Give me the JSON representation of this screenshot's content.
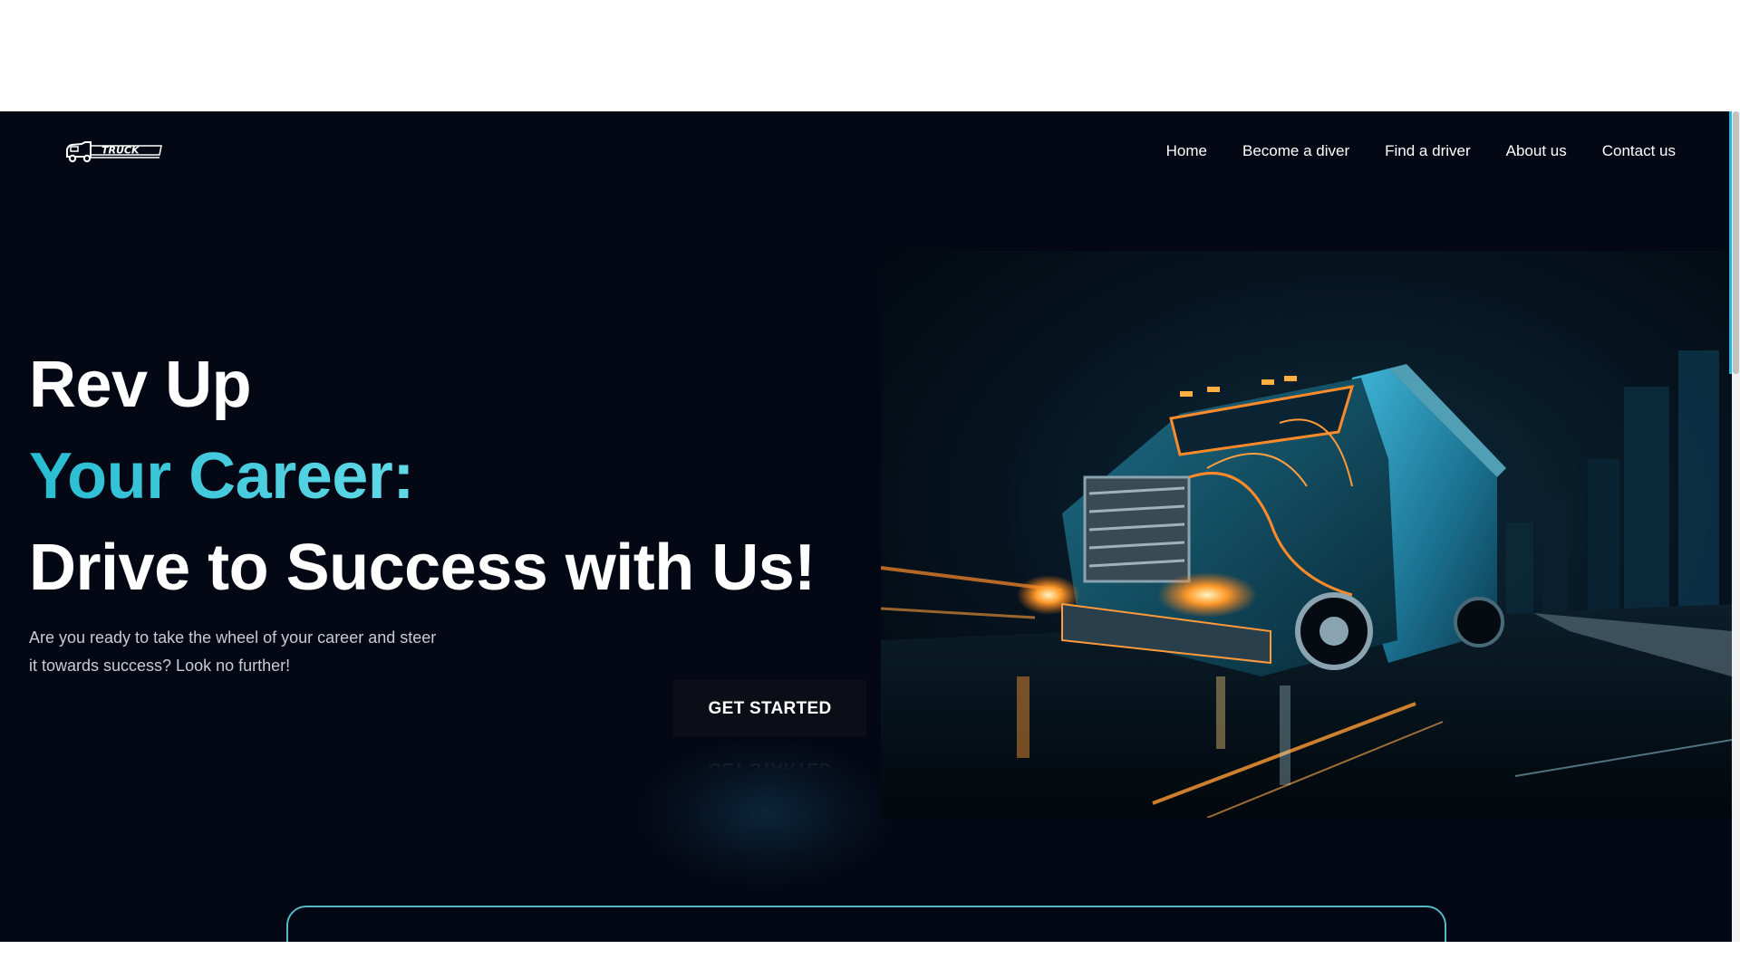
{
  "brand": {
    "logo_text": "TRUCK",
    "logo_icon": "truck-logo-icon"
  },
  "nav": {
    "items": [
      "Home",
      "Become a diver",
      "Find a driver",
      "About us",
      "Contact us"
    ]
  },
  "hero": {
    "line1": "Rev Up",
    "line2": "Your Career:",
    "line3": "Drive to Success with Us!",
    "subtext": "Are you ready to take the wheel of your career and steer it towards success? Look no further!",
    "cta_label": "GET STARTED",
    "image_icon": "neon-truck-illustration"
  },
  "colors": {
    "background": "#040814",
    "accent": "#3cc8dc",
    "text": "#ffffff",
    "muted_text": "#c9ccd3",
    "button_bg": "#0d0d18",
    "card_border": "#56b8c4"
  }
}
